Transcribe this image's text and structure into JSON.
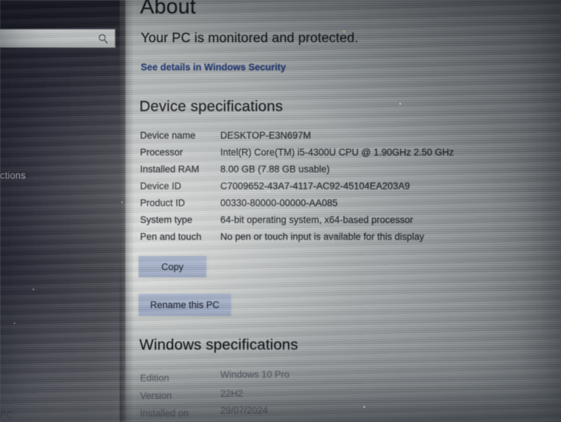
{
  "sidebar": {
    "search": {
      "value": "",
      "placeholder": "",
      "icon": "search-icon"
    },
    "nav_item_partial": "ctions",
    "nav_item_bottom": "PC"
  },
  "main": {
    "page_title": "About",
    "protection_status": "Your PC is monitored and protected.",
    "security_link": "See details in Windows Security",
    "device_specifications": {
      "heading": "Device specifications",
      "rows": [
        {
          "label": "Device name",
          "value": "DESKTOP-E3N697M"
        },
        {
          "label": "Processor",
          "value": "Intel(R) Core(TM) i5-4300U CPU @ 1.90GHz   2.50 GHz"
        },
        {
          "label": "Installed RAM",
          "value": "8.00 GB (7.88 GB usable)"
        },
        {
          "label": "Device ID",
          "value": "C7009652-43A7-4117-AC92-45104EA203A9"
        },
        {
          "label": "Product ID",
          "value": "00330-80000-00000-AA085"
        },
        {
          "label": "System type",
          "value": "64-bit operating system, x64-based processor"
        },
        {
          "label": "Pen and touch",
          "value": "No pen or touch input is available for this display"
        }
      ],
      "copy_button": "Copy",
      "rename_button": "Rename this PC"
    },
    "windows_specifications": {
      "heading": "Windows specifications",
      "rows": [
        {
          "label": "Edition",
          "value": "Windows 10 Pro"
        },
        {
          "label": "Version",
          "value": "22H2"
        },
        {
          "label": "Installed on",
          "value": "29/07/2024"
        }
      ]
    }
  },
  "colors": {
    "link": "#243a73",
    "button_face": "#a2aec6",
    "sidebar_bg": "#2b2b38",
    "content_bg": "#b2b6b6",
    "text": "#16181c"
  }
}
